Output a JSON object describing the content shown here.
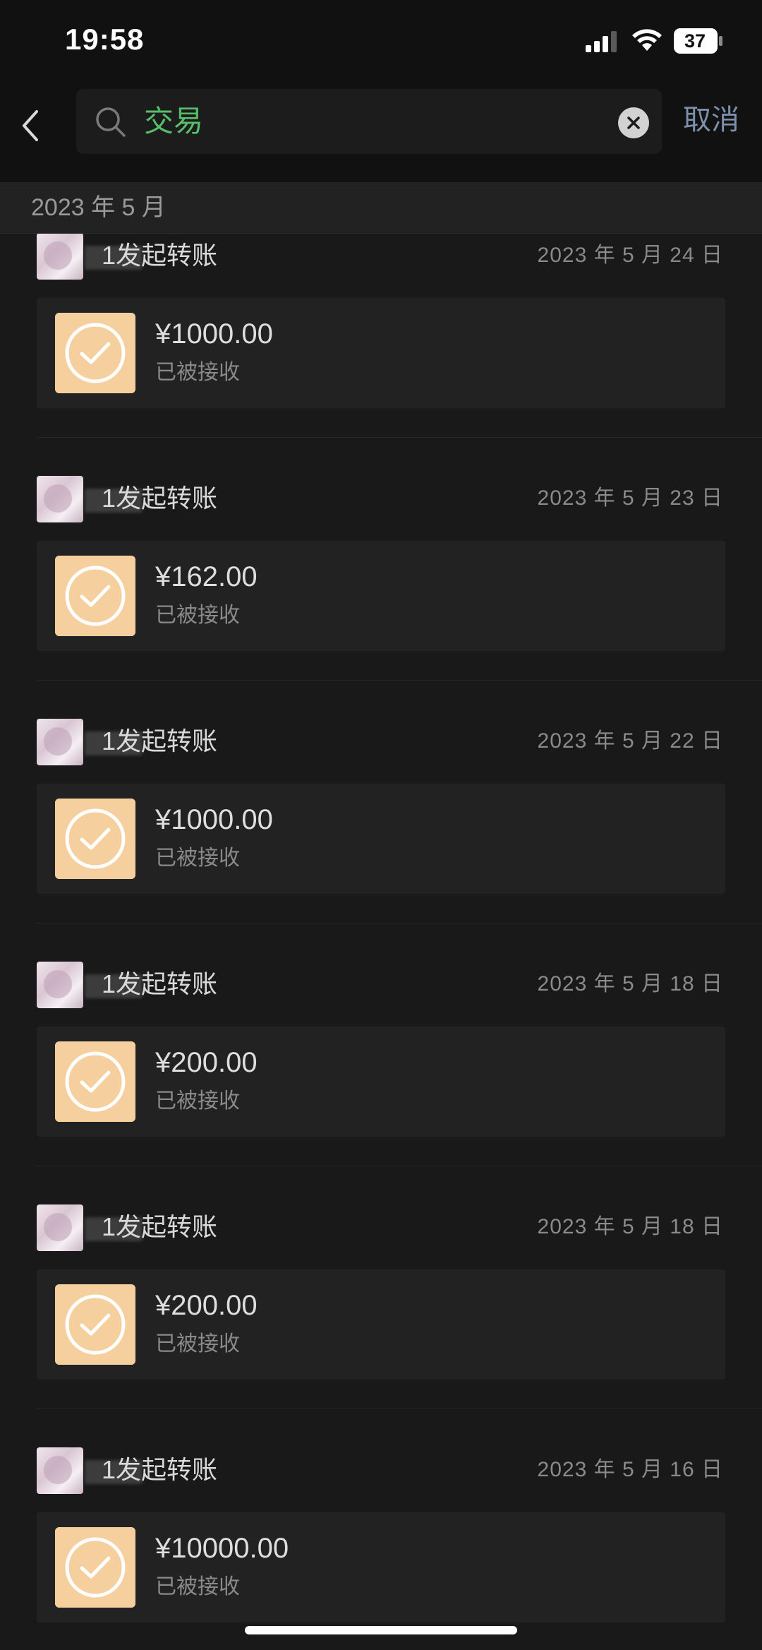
{
  "status_bar": {
    "time": "19:58",
    "battery_level": "37",
    "icons": [
      "signal-icon",
      "wifi-icon",
      "battery-icon"
    ]
  },
  "search": {
    "query": "交易",
    "cancel_label": "取消",
    "icons": [
      "back-icon",
      "search-icon",
      "clear-icon"
    ]
  },
  "section": {
    "month_label": "2023 年 5 月"
  },
  "records": [
    {
      "title": "1发起转账",
      "date": "2023 年 5 月 24 日",
      "amount": "¥1000.00",
      "status": "已被接收"
    },
    {
      "title": "1发起转账",
      "date": "2023 年 5 月 23 日",
      "amount": "¥162.00",
      "status": "已被接收"
    },
    {
      "title": "1发起转账",
      "date": "2023 年 5 月 22 日",
      "amount": "¥1000.00",
      "status": "已被接收"
    },
    {
      "title": "1发起转账",
      "date": "2023 年 5 月 18 日",
      "amount": "¥200.00",
      "status": "已被接收"
    },
    {
      "title": "1发起转账",
      "date": "2023 年 5 月 18 日",
      "amount": "¥200.00",
      "status": "已被接收"
    },
    {
      "title": "1发起转账",
      "date": "2023 年 5 月 16 日",
      "amount": "¥10000.00",
      "status": "已被接收"
    }
  ],
  "colors": {
    "background": "#191919",
    "header": "#111111",
    "card": "#222222",
    "transfer_icon": "#f6cf9f",
    "search_text": "#57bf6a",
    "cancel_text": "#7d90ab"
  }
}
